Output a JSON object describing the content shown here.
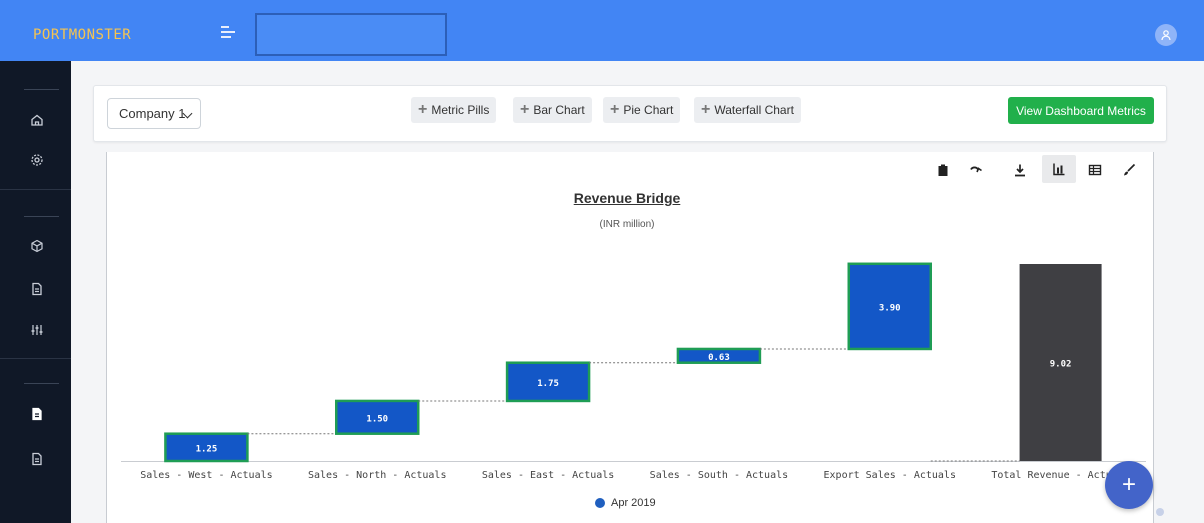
{
  "header": {
    "logo": "PORTMONSTER",
    "search_value": ""
  },
  "sidebar": {
    "icons": [
      "home-icon",
      "gear-icon",
      "cube-icon",
      "document-icon",
      "sliders-icon",
      "file-icon",
      "file-icon"
    ]
  },
  "toolbar": {
    "company_value": "Company 1",
    "add_buttons": [
      "Metric Pills",
      "Bar Chart",
      "Pie Chart",
      "Waterfall Chart"
    ],
    "view_button": "View Dashboard Metrics"
  },
  "chart_toolbar": {
    "icons": [
      "clipboard-icon",
      "redo-icon",
      "download-icon",
      "bar-chart-icon",
      "table-icon",
      "brush-icon"
    ]
  },
  "chart_data": {
    "type": "bar",
    "subtype": "waterfall",
    "title": "Revenue Bridge",
    "subtitle": "(INR million)",
    "categories": [
      "Sales - West - Actuals",
      "Sales - North - Actuals",
      "Sales - East - Actuals",
      "Sales - South - Actuals",
      "Export Sales - Actuals",
      "Total Revenue - Actuals"
    ],
    "values": [
      1.25,
      1.5,
      1.75,
      0.63,
      3.9,
      9.02
    ],
    "labels": [
      "1.25",
      "1.50",
      "1.75",
      "0.63",
      "3.90",
      "9.02"
    ],
    "is_total": [
      false,
      false,
      false,
      false,
      false,
      true
    ],
    "series": [
      {
        "name": "Apr 2019"
      }
    ],
    "ylim": [
      0,
      9.02
    ],
    "grid": false,
    "legend": "bottom",
    "colors": {
      "increment": "#1357c7",
      "increment_border": "#1f9d55",
      "total": "#3f3f43",
      "connector": "#777777"
    }
  }
}
